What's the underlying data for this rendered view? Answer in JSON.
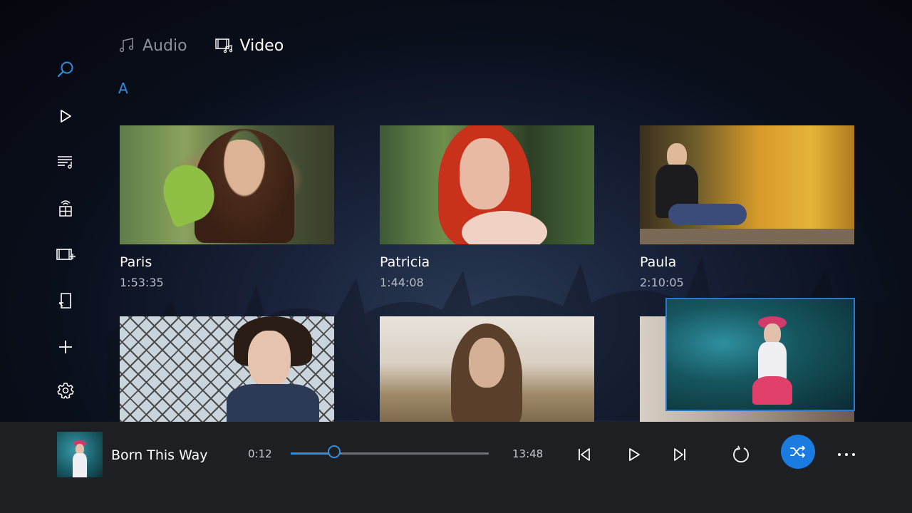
{
  "nav": {
    "icons": [
      "search-icon",
      "play-icon",
      "playlist-icon",
      "media-server-icon",
      "video-library-icon",
      "device-icon",
      "add-icon",
      "gear-icon"
    ]
  },
  "tabs": [
    {
      "label": "Audio",
      "icon": "music-note-icon",
      "active": false
    },
    {
      "label": "Video",
      "icon": "video-icon",
      "active": true
    }
  ],
  "section_letter": "A",
  "videos": [
    {
      "title": "Paris",
      "duration": "1:53:35"
    },
    {
      "title": "Patricia",
      "duration": "1:44:08"
    },
    {
      "title": "Paula",
      "duration": "2:10:05"
    },
    {
      "title": "",
      "duration": ""
    },
    {
      "title": "",
      "duration": ""
    },
    {
      "title": "",
      "duration": ""
    }
  ],
  "player": {
    "song_title": "Born This Way",
    "current_time": "0:12",
    "total_time": "13:48",
    "progress": 0.22,
    "shuffle_on": true
  },
  "colors": {
    "accent": "#1a7ce0",
    "player_bg": "#1e1f22",
    "inactive_text": "#8a8f98"
  }
}
